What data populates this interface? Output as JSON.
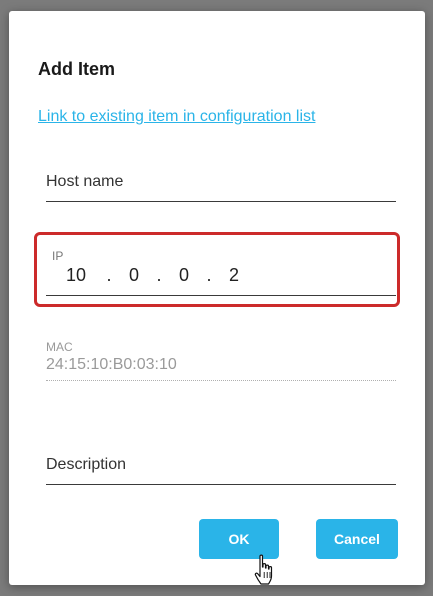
{
  "dialog": {
    "title": "Add Item",
    "link_text": "Link to existing item in configuration list"
  },
  "fields": {
    "host_name": {
      "placeholder": "Host name",
      "value": ""
    },
    "ip": {
      "label": "IP",
      "octets": [
        "10",
        "0",
        "0",
        "2"
      ],
      "separator": "."
    },
    "mac": {
      "label": "MAC",
      "value": "24:15:10:B0:03:10",
      "disabled": true
    },
    "description": {
      "placeholder": "Description",
      "value": ""
    }
  },
  "buttons": {
    "ok_label": "OK",
    "cancel_label": "Cancel"
  },
  "colors": {
    "accent": "#2ab4e8",
    "highlight": "#cc2a2a"
  },
  "icons": {
    "pointer": "hand-pointer-icon"
  }
}
